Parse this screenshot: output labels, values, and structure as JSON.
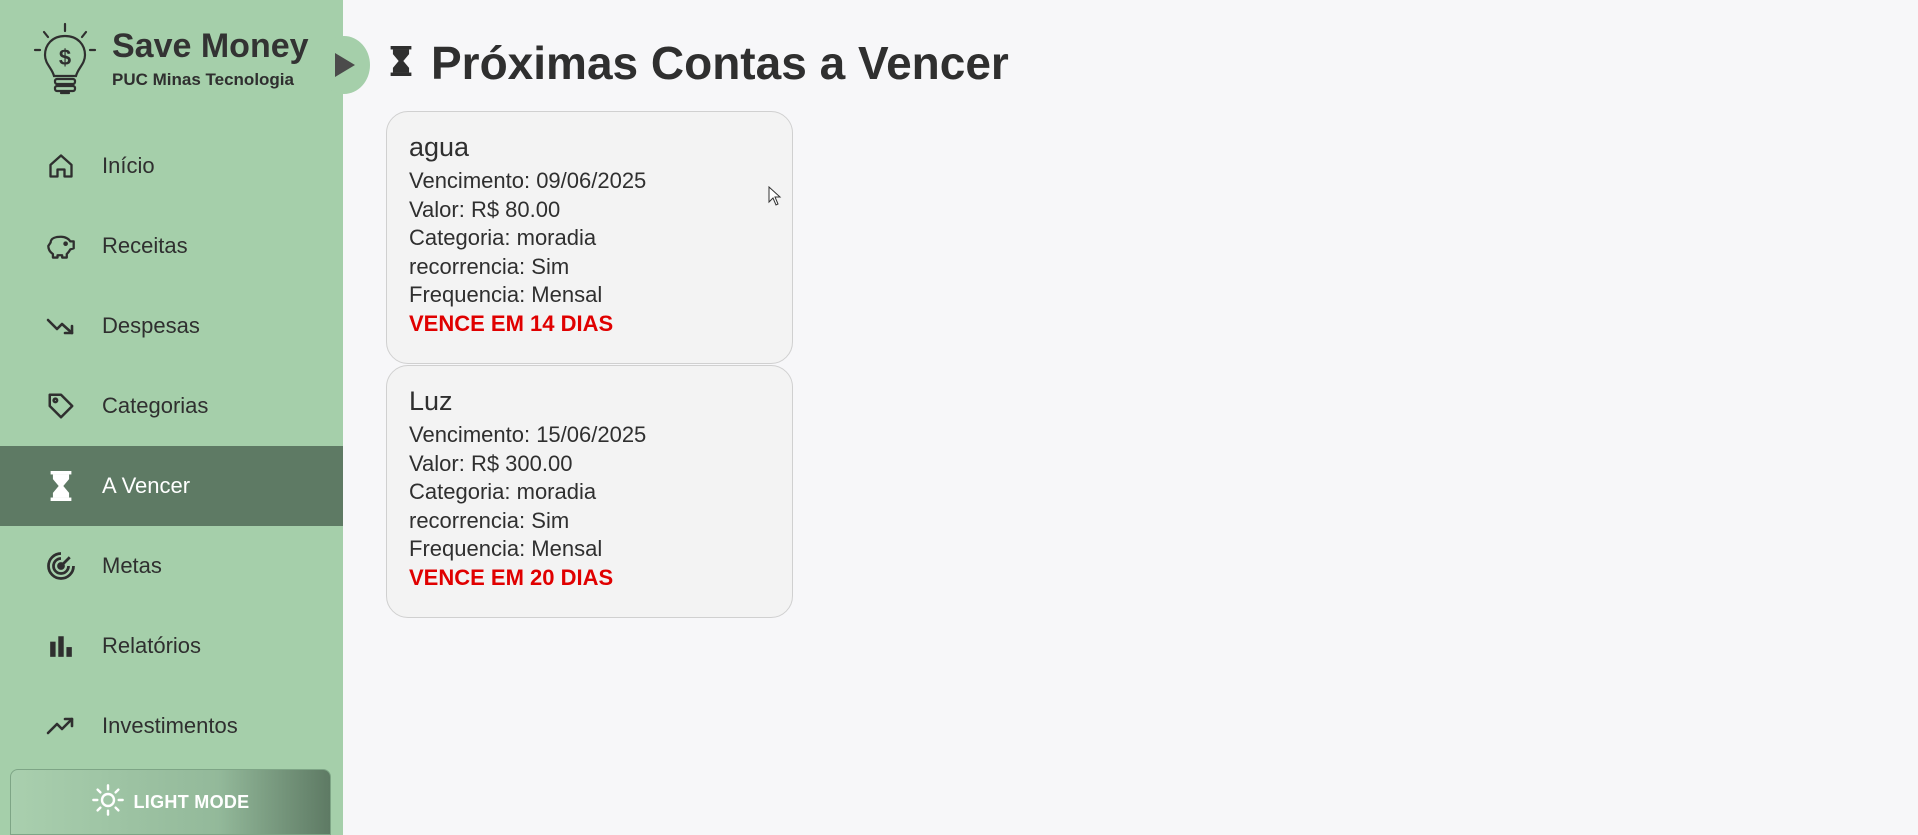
{
  "brand": {
    "title": "Save Money",
    "subtitle": "PUC Minas Tecnologia",
    "icon": "lightbulb-dollar-icon"
  },
  "sidebar": {
    "items": [
      {
        "label": "Início",
        "icon": "home-icon",
        "active": false
      },
      {
        "label": "Receitas",
        "icon": "piggy-bank-icon",
        "active": false
      },
      {
        "label": "Despesas",
        "icon": "trend-down-icon",
        "active": false
      },
      {
        "label": "Categorias",
        "icon": "tag-icon",
        "active": false
      },
      {
        "label": "A Vencer",
        "icon": "hourglass-icon",
        "active": true
      },
      {
        "label": "Metas",
        "icon": "target-icon",
        "active": false
      },
      {
        "label": "Relatórios",
        "icon": "bar-chart-icon",
        "active": false
      },
      {
        "label": "Investimentos",
        "icon": "trend-up-icon",
        "active": false
      }
    ],
    "mode_button": {
      "label": "LIGHT MODE",
      "icon": "sun-icon"
    }
  },
  "main": {
    "title": "Próximas Contas a Vencer",
    "title_icon": "hourglass-icon",
    "bills": [
      {
        "name": "agua",
        "due_date": "Vencimento: 09/06/2025",
        "value": "Valor: R$ 80.00",
        "category": "Categoria: moradia",
        "recurrence": "recorrencia: Sim",
        "frequency": "Frequencia: Mensal",
        "status": "VENCE EM 14 DIAS"
      },
      {
        "name": "Luz",
        "due_date": "Vencimento: 15/06/2025",
        "value": "Valor: R$ 300.00",
        "category": "Categoria: moradia",
        "recurrence": "recorrencia: Sim",
        "frequency": "Frequencia: Mensal",
        "status": "VENCE EM 20 DIAS"
      }
    ]
  },
  "colors": {
    "sidebar_bg": "#a5cfaa",
    "active_item_bg": "#5e7a64",
    "page_bg": "#f7f7f9",
    "due_text": "#e00000"
  }
}
